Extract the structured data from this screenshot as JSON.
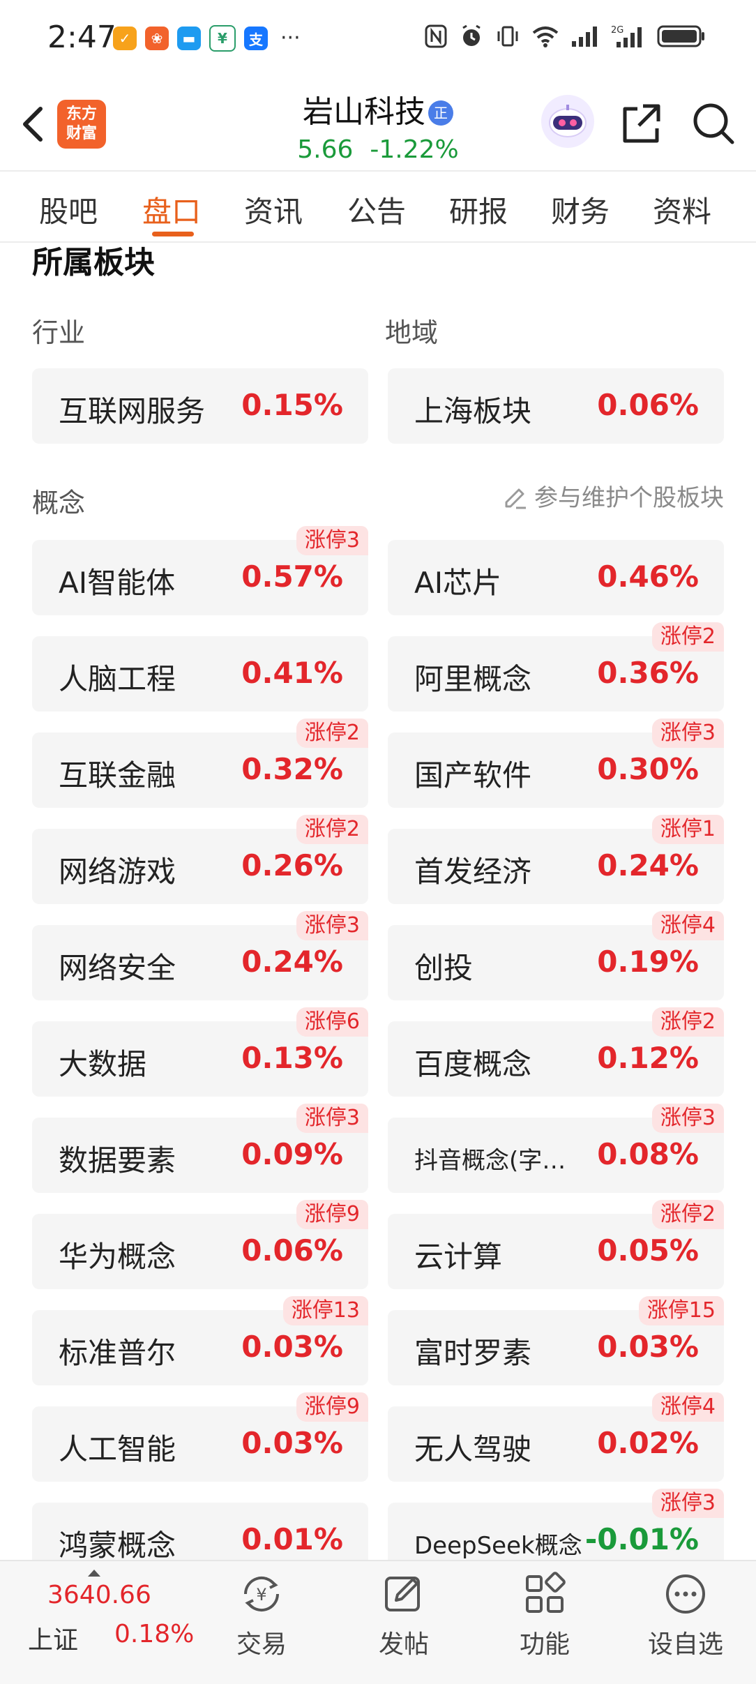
{
  "status_bar": {
    "time": "2:47",
    "more": "···",
    "app_icons": [
      "tasks-app-icon",
      "apps-icon",
      "message-app-icon",
      "finance-app-icon",
      "alipay-icon"
    ],
    "network_label": "2G"
  },
  "header": {
    "logo_line1": "东方",
    "logo_line2": "财富",
    "stock_name": "岩山科技",
    "badge": "正",
    "price": "5.66",
    "change": "-1.22%"
  },
  "tabs": [
    {
      "label": "股吧",
      "active": false
    },
    {
      "label": "盘口",
      "active": true
    },
    {
      "label": "资讯",
      "active": false
    },
    {
      "label": "公告",
      "active": false
    },
    {
      "label": "研报",
      "active": false
    },
    {
      "label": "财务",
      "active": false
    },
    {
      "label": "资料",
      "active": false
    }
  ],
  "section": {
    "title": "所属板块",
    "industry_label": "行业",
    "region_label": "地域",
    "concept_label": "概念",
    "maintain_label": "参与维护个股板块"
  },
  "industry": {
    "name": "互联网服务",
    "pct": "0.15%"
  },
  "region": {
    "name": "上海板块",
    "pct": "0.06%"
  },
  "concepts": [
    {
      "name": "AI智能体",
      "pct": "0.57%",
      "badge": "涨停3"
    },
    {
      "name": "AI芯片",
      "pct": "0.46%",
      "badge": ""
    },
    {
      "name": "人脑工程",
      "pct": "0.41%",
      "badge": ""
    },
    {
      "name": "阿里概念",
      "pct": "0.36%",
      "badge": "涨停2"
    },
    {
      "name": "互联金融",
      "pct": "0.32%",
      "badge": "涨停2"
    },
    {
      "name": "国产软件",
      "pct": "0.30%",
      "badge": "涨停3"
    },
    {
      "name": "网络游戏",
      "pct": "0.26%",
      "badge": "涨停2"
    },
    {
      "name": "首发经济",
      "pct": "0.24%",
      "badge": "涨停1"
    },
    {
      "name": "网络安全",
      "pct": "0.24%",
      "badge": "涨停3"
    },
    {
      "name": "创投",
      "pct": "0.19%",
      "badge": "涨停4"
    },
    {
      "name": "大数据",
      "pct": "0.13%",
      "badge": "涨停6"
    },
    {
      "name": "百度概念",
      "pct": "0.12%",
      "badge": "涨停2"
    },
    {
      "name": "数据要素",
      "pct": "0.09%",
      "badge": "涨停3"
    },
    {
      "name": "抖音概念(字…",
      "pct": "0.08%",
      "badge": "涨停3"
    },
    {
      "name": "华为概念",
      "pct": "0.06%",
      "badge": "涨停9"
    },
    {
      "name": "云计算",
      "pct": "0.05%",
      "badge": "涨停2"
    },
    {
      "name": "标准普尔",
      "pct": "0.03%",
      "badge": "涨停13"
    },
    {
      "name": "富时罗素",
      "pct": "0.03%",
      "badge": "涨停15"
    },
    {
      "name": "人工智能",
      "pct": "0.03%",
      "badge": "涨停9"
    },
    {
      "name": "无人驾驶",
      "pct": "0.02%",
      "badge": "涨停4"
    },
    {
      "name": "鸿蒙概念",
      "pct": "0.01%",
      "badge": ""
    },
    {
      "name": "DeepSeek概念",
      "pct": "-0.01%",
      "badge": "涨停3"
    }
  ],
  "bottom_bar": {
    "index_value": "3640.66",
    "index_name": "上证",
    "index_change": "0.18%",
    "nav": [
      {
        "label": "交易",
        "icon": "trade-icon"
      },
      {
        "label": "发帖",
        "icon": "post-icon"
      },
      {
        "label": "功能",
        "icon": "functions-icon"
      },
      {
        "label": "设自选",
        "icon": "watchlist-icon"
      }
    ]
  },
  "colors": {
    "up": "#e3262b",
    "down": "#1a9a3a",
    "accent": "#e8601c",
    "card_bg": "#f5f5f5",
    "badge_bg": "#fde3e3"
  }
}
